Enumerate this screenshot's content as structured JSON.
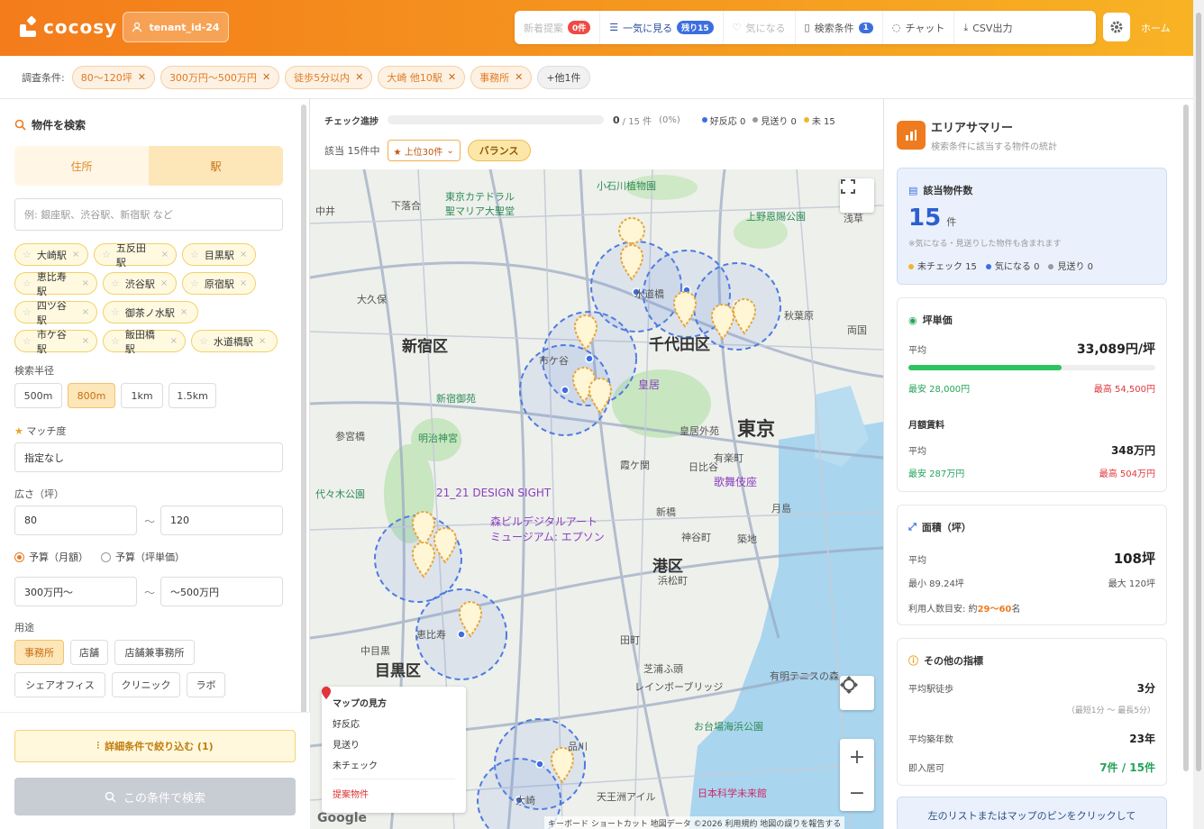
{
  "app": {
    "brand": "cocosy",
    "tenant": "tenant_id-24",
    "home_label": "ホーム",
    "accent_color": "#f47c1b"
  },
  "toolbar": {
    "new": {
      "label": "新着提案",
      "badge": "0件"
    },
    "bulk": {
      "label": "一気に見る",
      "badge": "残り15"
    },
    "favorite": {
      "label": "気になる"
    },
    "conditions": {
      "label": "検索条件",
      "badge": "1"
    },
    "chat": {
      "label": "チャット"
    },
    "csv": {
      "label": "CSV出力"
    }
  },
  "filterbar": {
    "label": "調査条件:",
    "chips": [
      "80〜120坪",
      "300万円〜500万円",
      "徒歩5分以内",
      "大崎 他10駅",
      "事務所"
    ],
    "more": "+他1件"
  },
  "left": {
    "title": "物件を検索",
    "tabs": [
      "住所",
      "駅"
    ],
    "active_tab": "駅",
    "station_placeholder": "例: 銀座駅、渋谷駅、新宿駅 など",
    "stations": [
      "大崎駅",
      "五反田駅",
      "目黒駅",
      "恵比寿駅",
      "渋谷駅",
      "原宿駅",
      "四ツ谷駅",
      "御茶ノ水駅",
      "市ケ谷駅",
      "飯田橋駅",
      "水道橋駅"
    ],
    "radius_label": "検索半径",
    "radius_options": [
      "500m",
      "800m",
      "1km",
      "1.5km"
    ],
    "radius_selected": "800m",
    "match_label": "マッチ度",
    "match_value": "指定なし",
    "area_label": "広さ（坪）",
    "area_min": "80",
    "area_max": "120",
    "tilde": "〜",
    "budget_monthly": "予算（月額）",
    "budget_tsubo": "予算（坪単価）",
    "budget_min": "300万円〜",
    "budget_max": "〜500万円",
    "use_label": "用途",
    "uses": [
      "事務所",
      "店舗",
      "店舗兼事務所",
      "シェアオフィス",
      "クリニック",
      "ラボ"
    ],
    "use_selected": "事務所",
    "detail_button": "詳細条件で絞り込む (1)",
    "search_button": "この条件で検索"
  },
  "map_panel": {
    "progress_label": "チェック進捗",
    "progress_count": "0",
    "progress_total": "/ 15 件",
    "progress_pct": "(0%)",
    "progress_value": 0,
    "legend_good": "好反応 0",
    "legend_skip": "見送り 0",
    "legend_unchecked": "未 15",
    "match_text": "該当 15件中",
    "top_select": "★ 上位30件",
    "balance": "バランス",
    "labels": {
      "shinjuku": "新宿区",
      "chiyoda": "千代田区",
      "minato": "港区",
      "meguro": "目黒区",
      "tokyo": "東京",
      "cathedral": "東京カテドラル\n聖マリア大聖堂",
      "koishikawa": "小石川植物園",
      "ueno": "上野恩賜公園",
      "kokyo": "皇居",
      "kokyo_gaien": "皇居外苑",
      "meiji": "明治神宮",
      "shinjuku_gyoen": "新宿御苑",
      "yoyogi": "代々木公園",
      "design_sight": "21_21 DESIGN SIGHT",
      "mori": "森ビルデジタルアート\nミュージアム: エプソン",
      "kabukiza": "歌舞伎座",
      "odaiba": "お台場海浜公園",
      "nihon_kagaku": "日本科学未来館",
      "rainbow": "レインボーブリッジ",
      "shibaura": "芝浦ふ頭",
      "ariake": "有明テニスの森",
      "asakusa": "浅草",
      "akihabara": "秋葉原",
      "ryogoku": "両国",
      "nakano": "中井",
      "okubo": "大久保",
      "shimoochiai": "下落合",
      "ichigaya": "市ケ谷",
      "suidobashi": "水道橋",
      "ebisu": "恵比寿",
      "ohsaki": "大崎",
      "shinagawa": "品川",
      "hamamatsucho": "浜松町",
      "tamachi": "田町",
      "naka_meguro": "中目黒",
      "sangubashi": "参宮橋",
      "shinbashi": "新橋",
      "yurakucho": "有楽町",
      "kasumigaseki": "霞ケ関",
      "tennozu": "天王洲アイル",
      "kamiya": "神谷町",
      "kiyosumi": "月島",
      "tsukiji": "築地",
      "hibiya": "日比谷"
    },
    "legend_title": "マップの見方",
    "legend_items": [
      "好反応",
      "見送り",
      "未チェック",
      "提案物件"
    ],
    "attribution": "キーボード ショートカット   地図データ ©2026   利用規約   地図の誤りを報告する",
    "google": "Google"
  },
  "summary": {
    "title": "エリアサマリー",
    "subtitle": "検索条件に該当する物件の統計",
    "count_label": "該当物件数",
    "count": "15",
    "count_unit": "件",
    "count_note": "※気になる・見送りした物件も含まれます",
    "unchecked": "未チェック 15",
    "favorite": "気になる 0",
    "skipped": "見送り 0",
    "tsubo_label": "坪単価",
    "avg_label": "平均",
    "tsubo_avg": "33,089円/坪",
    "tsubo_bar": 0.62,
    "tsubo_min": "最安 28,000円",
    "tsubo_max": "最高 54,500円",
    "rent_label": "月額賃料",
    "rent_avg": "348万円",
    "rent_min": "最安 287万円",
    "rent_max": "最高 504万円",
    "area_label": "面積（坪）",
    "area_avg": "108坪",
    "area_min": "最小 89.24坪",
    "area_max": "最大 120坪",
    "people_prefix": "利用人数目安: 約",
    "people_range": "29〜60",
    "people_suffix": "名",
    "other_label": "その他の指標",
    "walk_label": "平均駅徒歩",
    "walk_avg": "3分",
    "walk_range": "（最短1分 〜 最長5分）",
    "age_label": "平均築年数",
    "age_avg": "23年",
    "immediate_label": "即入居可",
    "immediate": "7件 / 15件",
    "hint": "左のリストまたはマップのピンをクリックして"
  }
}
